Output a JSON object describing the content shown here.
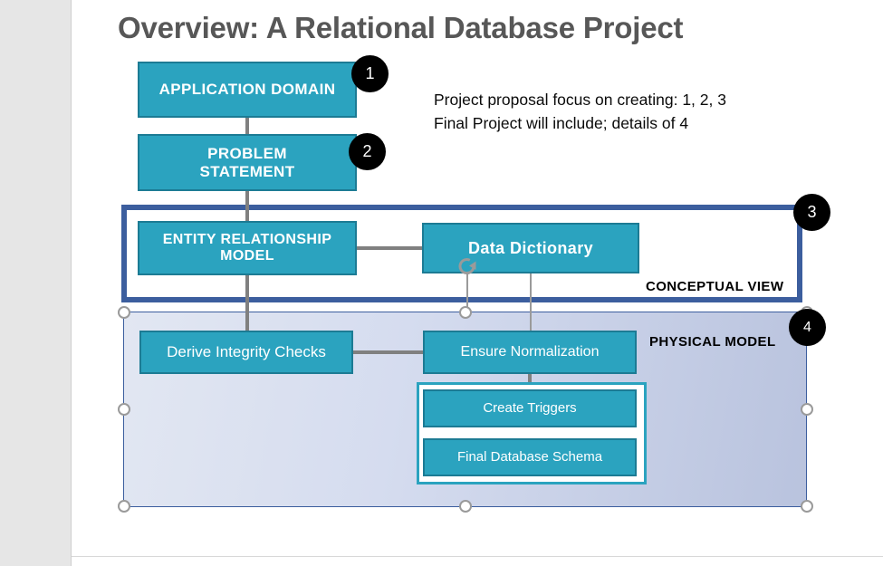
{
  "slide": {
    "title": "Overview: A Relational Database Project",
    "note_lines": [
      "Project proposal focus on creating: 1, 2, 3",
      "Final Project will include; details of 4"
    ],
    "note_text": "Project proposal focus on creating: 1, 2, 3\nFinal Project will include; details of 4"
  },
  "boxes": {
    "application_domain": "APPLICATION DOMAIN",
    "problem_statement": "PROBLEM\nSTATEMENT",
    "entity_relationship_model": "ENTITY RELATIONSHIP\nMODEL",
    "data_dictionary": "Data  Dictionary",
    "derive_integrity_checks": "Derive Integrity Checks",
    "ensure_normalization": "Ensure Normalization",
    "create_triggers": "Create Triggers",
    "final_database_schema": "Final Database Schema"
  },
  "regions": {
    "conceptual_view_label": "CONCEPTUAL VIEW",
    "physical_model_label": "PHYSICAL MODEL"
  },
  "badges": {
    "one": "1",
    "two": "2",
    "three": "3",
    "four": "4"
  },
  "colors": {
    "box_fill": "#2ba3bf",
    "box_border": "#1c7b94",
    "conceptual_border": "#3c5e9e",
    "title_color": "#575757",
    "badge_fill": "#000000",
    "connector": "#808080",
    "physical_gradient_start": "#e2e7f2",
    "physical_gradient_end": "#b9c3de"
  },
  "icons": {
    "rotate": "rotate-handle-icon"
  }
}
